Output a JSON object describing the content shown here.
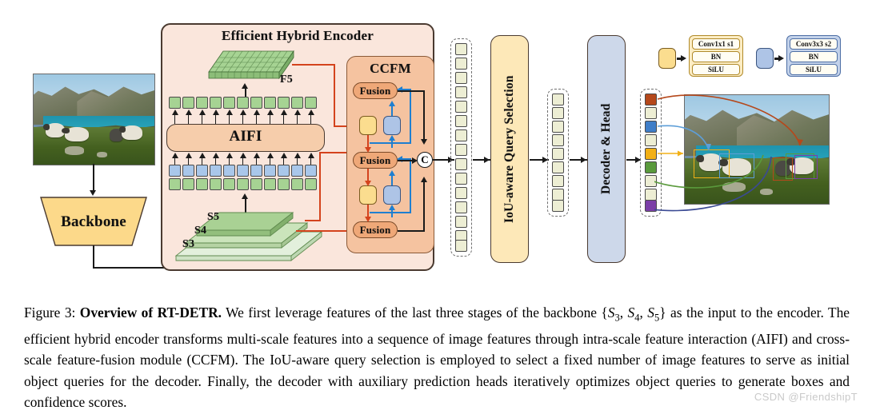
{
  "figure": {
    "label": "Figure 3:",
    "title": "Overview of RT-DETR.",
    "body_1": " We first leverage features of the last three stages of the backbone ",
    "set_open": "{",
    "s3": "S",
    "s3sub": "3",
    "c1": ", ",
    "s4": "S",
    "s4sub": "4",
    "c2": ", ",
    "s5": "S",
    "s5sub": "5",
    "set_close": "}",
    "body_2": " as the input to the encoder. The efficient hybrid encoder transforms multi-scale features into a sequence of image features through intra-scale feature interaction (AIFI) and cross-scale feature-fusion module (CCFM). The IoU-aware query selection is employed to select a fixed number of image features to serve as initial object queries for the decoder. Finally, the decoder with auxiliary prediction heads iteratively optimizes object queries to generate boxes and confidence scores."
  },
  "watermark": "CSDN @FriendshipT",
  "diagram": {
    "backbone_label": "Backbone",
    "encoder_title": "Efficient Hybrid Encoder",
    "aifi_label": "AIFI",
    "ccfm_title": "CCFM",
    "f5_label": "F5",
    "scale_labels": [
      "S5",
      "S4",
      "S3"
    ],
    "fusion_label": "Fusion",
    "concat_symbol": "C",
    "query_selection_label": "IoU-aware Query Selection",
    "decoder_label": "Decoder &  Head"
  },
  "legend": {
    "yellow_block": {
      "rows": [
        "Conv1x1 s1",
        "BN",
        "SiLU"
      ],
      "color": "#f8cf72",
      "panel": "#fdedc4"
    },
    "blue_block": {
      "rows": [
        "Conv3x3 s2",
        "BN",
        "SiLU"
      ],
      "color": "#a8bfe3",
      "panel": "#c3d2ea"
    }
  },
  "colors": {
    "encoder_bg": "#fae6dc",
    "encoder_border": "#4a3a30",
    "aifi_fill": "#f6cdab",
    "ccfm_fill": "#f5c3a0",
    "fusion_fill": "#efa878",
    "token_green": "#a6d393",
    "token_blue": "#a9c7ea",
    "token_cream": "#edeed4",
    "yellow_node": "#fbdd8f",
    "blue_node": "#aec4e6",
    "backbone_fill": "#fcd98a",
    "query_fill": "#fde8b8",
    "decoder_fill": "#cdd8ea",
    "red_arrow": "#d4431d",
    "blue_arrow": "#1f7fd0",
    "s5": "#a9d194",
    "s4": "#cbe4bb",
    "s3": "#e3f0dc"
  },
  "detections": {
    "query_token_colors": [
      "#b5481b",
      "#edeed4",
      "#3f7ec8",
      "#edeed4",
      "#f2b016",
      "#5a9a3c",
      "#edeed4",
      "#edeed4",
      "#7b3fa8"
    ],
    "box_colors": [
      "#b5481b",
      "#3f7ec8",
      "#f2b016",
      "#5a9a3c",
      "#7b3fa8",
      "#3b4a94"
    ]
  },
  "counts": {
    "tokens_per_aifi_row": 11,
    "f5_grid_cols": 11,
    "f5_grid_rows": 5,
    "seq_column_1": 15,
    "seq_column_2": 9,
    "seq_column_3": 9
  }
}
